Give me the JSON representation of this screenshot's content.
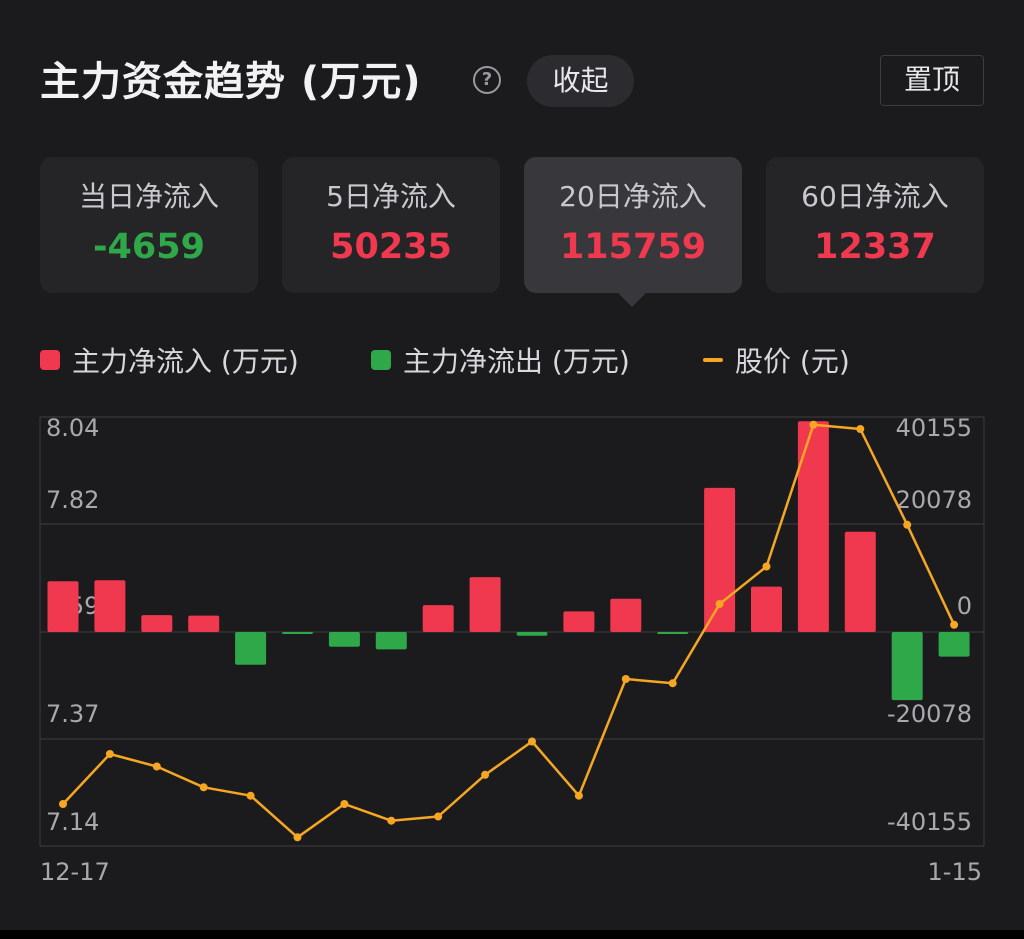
{
  "header": {
    "title": "主力资金趋势 (万元)",
    "help_icon": "question-circle-icon",
    "collapse_label": "收起",
    "pin_label": "置顶"
  },
  "periods": [
    {
      "label": "当日净流入",
      "value": "-4659",
      "trend": "neg",
      "active": false
    },
    {
      "label": "5日净流入",
      "value": "50235",
      "trend": "pos",
      "active": false
    },
    {
      "label": "20日净流入",
      "value": "115759",
      "trend": "pos",
      "active": true
    },
    {
      "label": "60日净流入",
      "value": "12337",
      "trend": "pos",
      "active": false
    }
  ],
  "legend": {
    "inflow": "主力净流入 (万元)",
    "outflow": "主力净流出 (万元)",
    "price": "股价 (元)"
  },
  "colors": {
    "inflow": "#f0384e",
    "outflow": "#2fa84a",
    "price": "#f5a623",
    "grid": "#38383d",
    "background": "#1b1b1d"
  },
  "chart_data": {
    "type": "bar",
    "x_start_label": "12-17",
    "x_end_label": "1-15",
    "left_axis": {
      "ticks": [
        "8.04",
        "7.82",
        "7.59",
        "7.37",
        "7.14"
      ],
      "range": [
        7.14,
        8.04
      ]
    },
    "right_axis": {
      "ticks": [
        "40155",
        "20078",
        "0",
        "-20078",
        "-40155"
      ],
      "range": [
        -40155,
        40155
      ]
    },
    "series": [
      {
        "name": "主力净流入 (万元)",
        "kind": "bar",
        "values": [
          9600,
          9800,
          3200,
          3100,
          -6200,
          -300,
          -2800,
          -3300,
          5100,
          10400,
          -700,
          3900,
          6300,
          -200,
          27300,
          8600,
          39900,
          19000,
          -12900,
          -4659
        ]
      },
      {
        "name": "股价 (元)",
        "kind": "line",
        "values": [
          7.14,
          7.26,
          7.23,
          7.18,
          7.16,
          7.06,
          7.14,
          7.1,
          7.11,
          7.21,
          7.29,
          7.16,
          7.44,
          7.43,
          7.62,
          7.71,
          8.05,
          8.04,
          7.81,
          7.57
        ]
      }
    ]
  }
}
